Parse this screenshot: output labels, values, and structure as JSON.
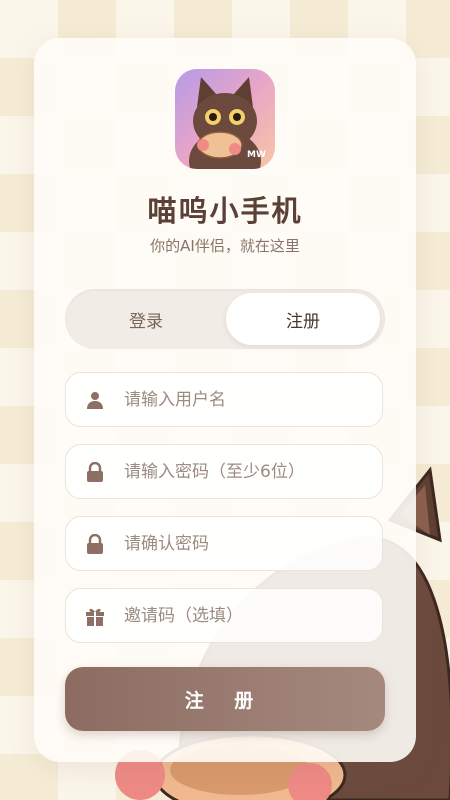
{
  "app": {
    "title": "喵呜小手机",
    "subtitle": "你的AI伴侣，就在这里",
    "logo_badge_text": "MW"
  },
  "tabs": [
    {
      "label": "登录",
      "active": false
    },
    {
      "label": "注册",
      "active": true
    }
  ],
  "form": {
    "username_placeholder": "请输入用户名",
    "password_placeholder": "请输入密码（至少6位）",
    "confirm_placeholder": "请确认密码",
    "invite_placeholder": "邀请码（选填）",
    "submit_label": "注 册"
  },
  "icons": {
    "username": "user-icon",
    "password": "lock-icon",
    "confirm": "lock-icon",
    "invite": "gift-icon"
  },
  "colors": {
    "accent": "#8c6c61",
    "title": "#5b4037",
    "icon": "#8d6f63"
  }
}
